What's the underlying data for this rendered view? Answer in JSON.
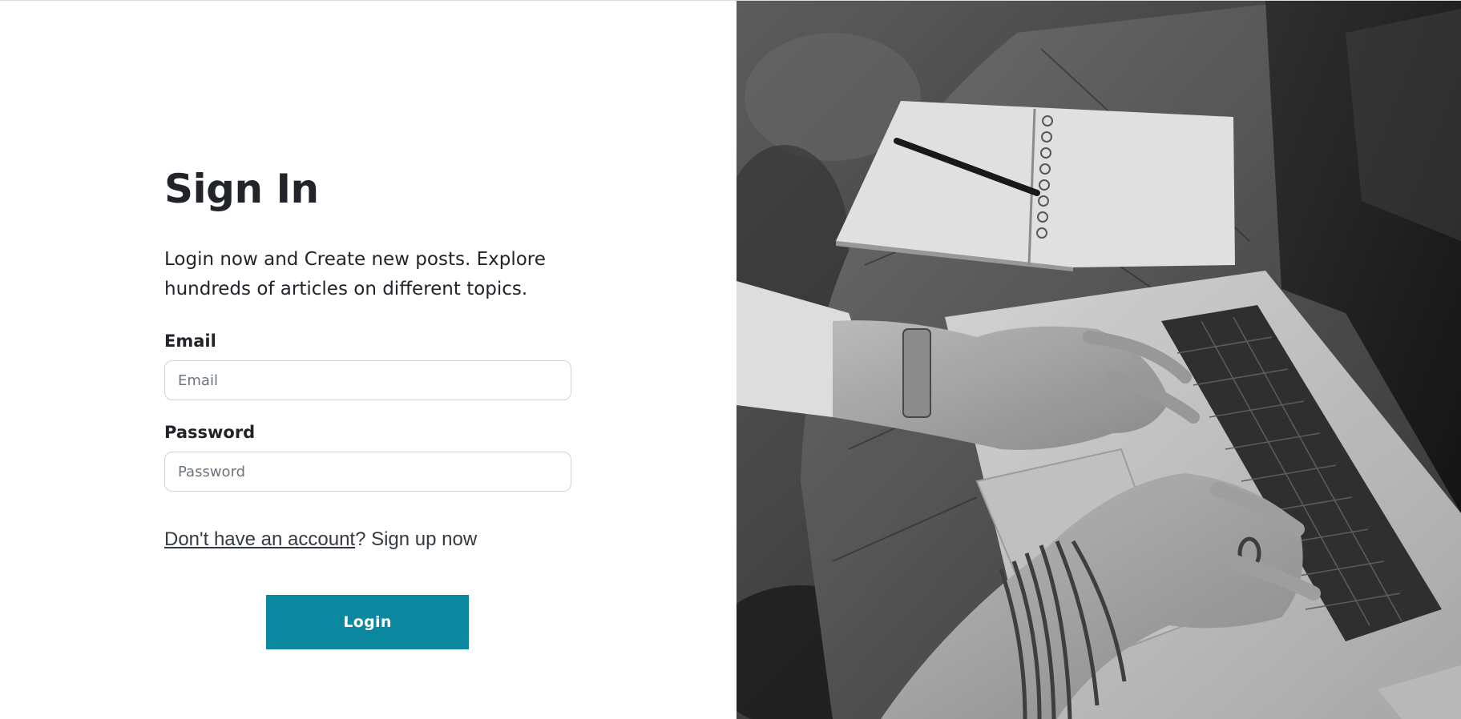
{
  "signin": {
    "title": "Sign In",
    "subtitle": "Login now and Create new posts. Explore hundreds of articles on different topics.",
    "email": {
      "label": "Email",
      "placeholder": "Email",
      "value": ""
    },
    "password": {
      "label": "Password",
      "placeholder": "Password",
      "value": ""
    },
    "signup_link": "Don't have an account",
    "signup_suffix": "? Sign up now",
    "login_button": "Login"
  },
  "hero_image": {
    "subject": "hands typing on a laptop beside a spiral notebook and pen, black and white photo"
  },
  "colors": {
    "button": "#0b87a0",
    "text": "#212529",
    "input_border": "#ced4da"
  }
}
